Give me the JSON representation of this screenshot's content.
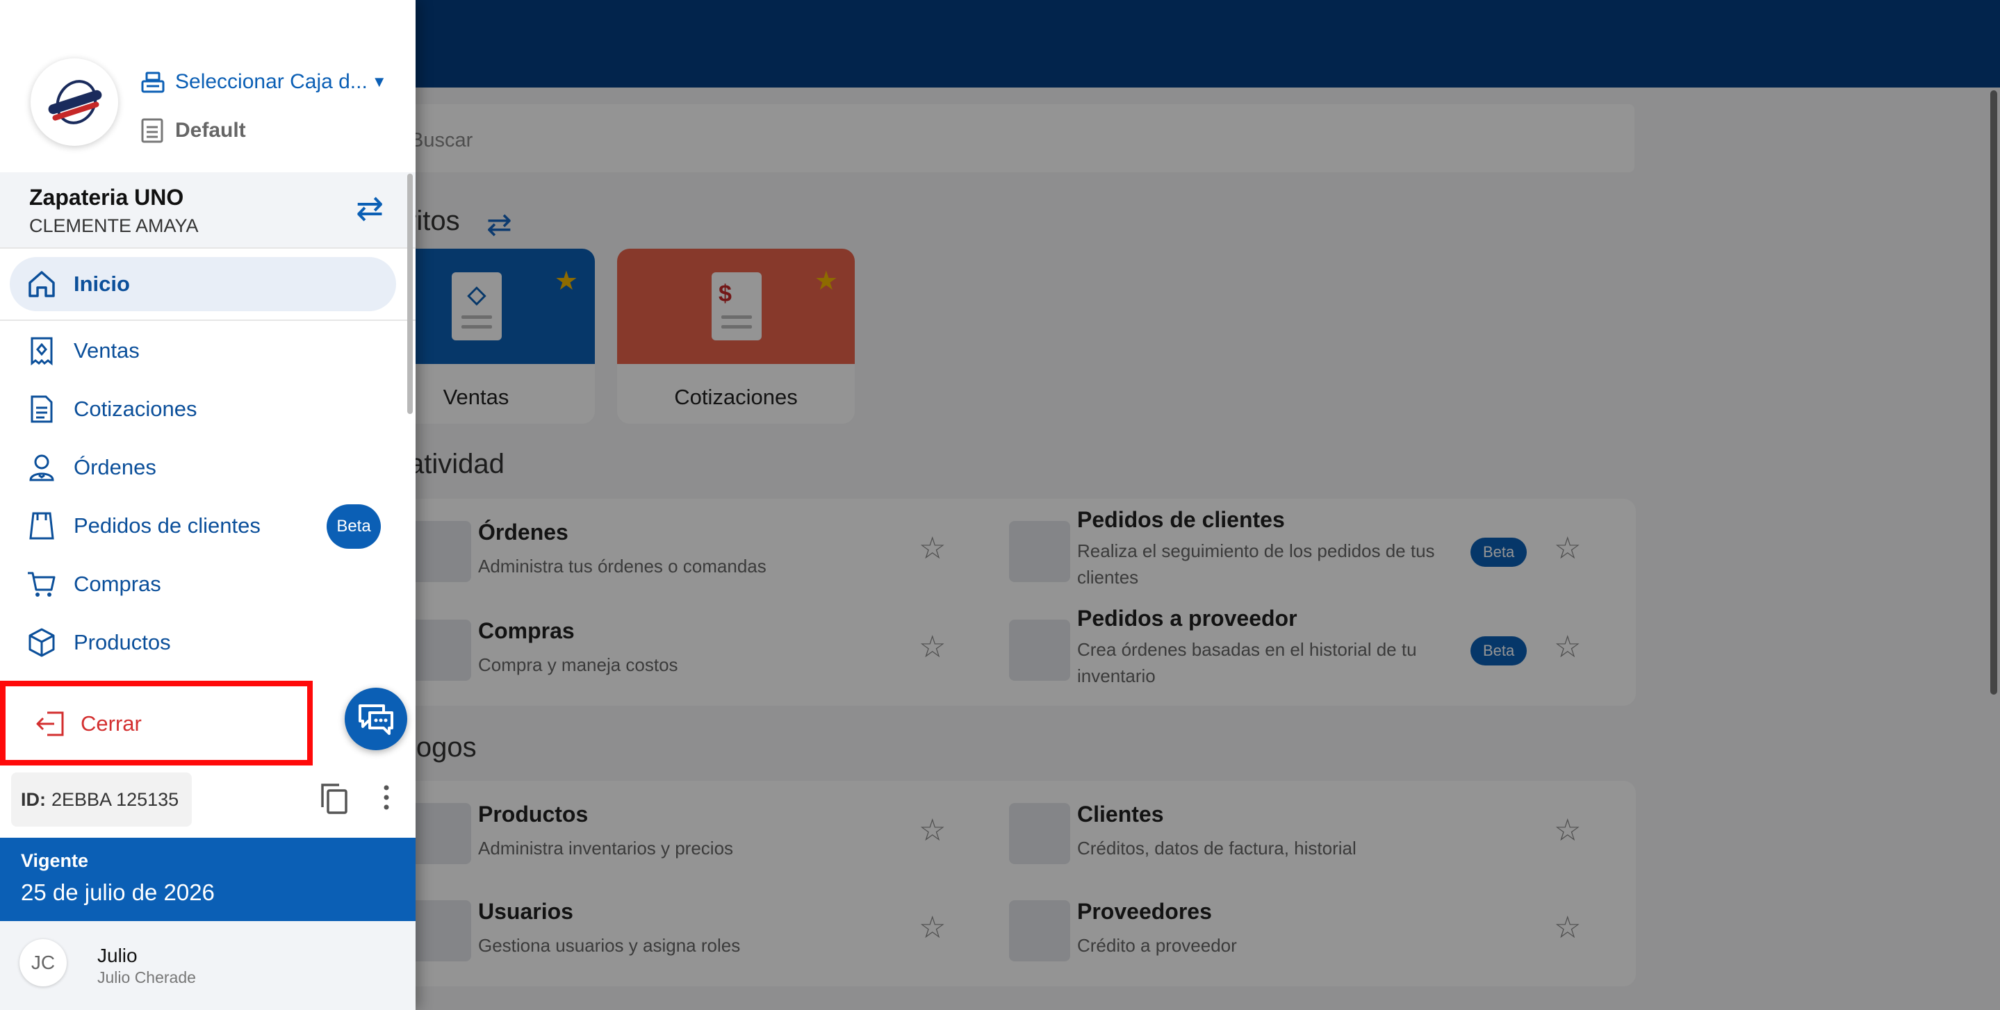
{
  "search": {
    "placeholder": "Buscar"
  },
  "sections": {
    "favoritos": "ritos",
    "productividad": "atividad",
    "catalogos": "logos"
  },
  "favorites": [
    {
      "label": "Ventas",
      "color": "#0b5fb5"
    },
    {
      "label": "Cotizaciones",
      "color": "#e8624a"
    }
  ],
  "productivity": [
    {
      "title": "Órdenes",
      "desc": "Administra tus órdenes o comandas"
    },
    {
      "title": "Pedidos de clientes",
      "desc": "Realiza el seguimiento de los pedidos de tus",
      "desc2": "clientes",
      "badge": "Beta"
    },
    {
      "title": "Compras",
      "desc": "Compra y maneja costos"
    },
    {
      "title": "Pedidos a proveedor",
      "desc": "Crea órdenes basadas en el historial de tu",
      "desc2": "inventario",
      "badge": "Beta"
    }
  ],
  "catalogs": [
    {
      "title": "Productos",
      "desc": "Administra inventarios y precios"
    },
    {
      "title": "Clientes",
      "desc": "Créditos, datos de factura, historial"
    },
    {
      "title": "Usuarios",
      "desc": "Gestiona usuarios y asigna roles"
    },
    {
      "title": "Proveedores",
      "desc": "Crédito a proveedor"
    }
  ],
  "drawer": {
    "caja_select": "Seleccionar Caja d...",
    "warehouse": "Default",
    "store_name": "Zapateria UNO",
    "store_user": "CLEMENTE AMAYA",
    "nav": [
      {
        "label": "Inicio",
        "icon": "home-icon"
      },
      {
        "label": "Ventas",
        "icon": "receipt-icon"
      },
      {
        "label": "Cotizaciones",
        "icon": "document-icon"
      },
      {
        "label": "Órdenes",
        "icon": "waiter-icon"
      },
      {
        "label": "Pedidos de clientes",
        "icon": "bag-icon",
        "badge": "Beta"
      },
      {
        "label": "Compras",
        "icon": "cart-icon"
      },
      {
        "label": "Productos",
        "icon": "box-icon"
      }
    ],
    "logout": "Cerrar",
    "id_label": "ID:",
    "id_value": "2EBBA 125135",
    "license_status": "Vigente",
    "license_date": "25 de julio de 2026",
    "user_initials": "JC",
    "user_name": "Julio",
    "user_fullname": "Julio Cherade"
  },
  "colors": {
    "primary": "#0b5fb5",
    "topbar": "#053e84",
    "highlight": "#ff0a0a",
    "logout": "#d32f2f",
    "star": "#f5b800"
  }
}
